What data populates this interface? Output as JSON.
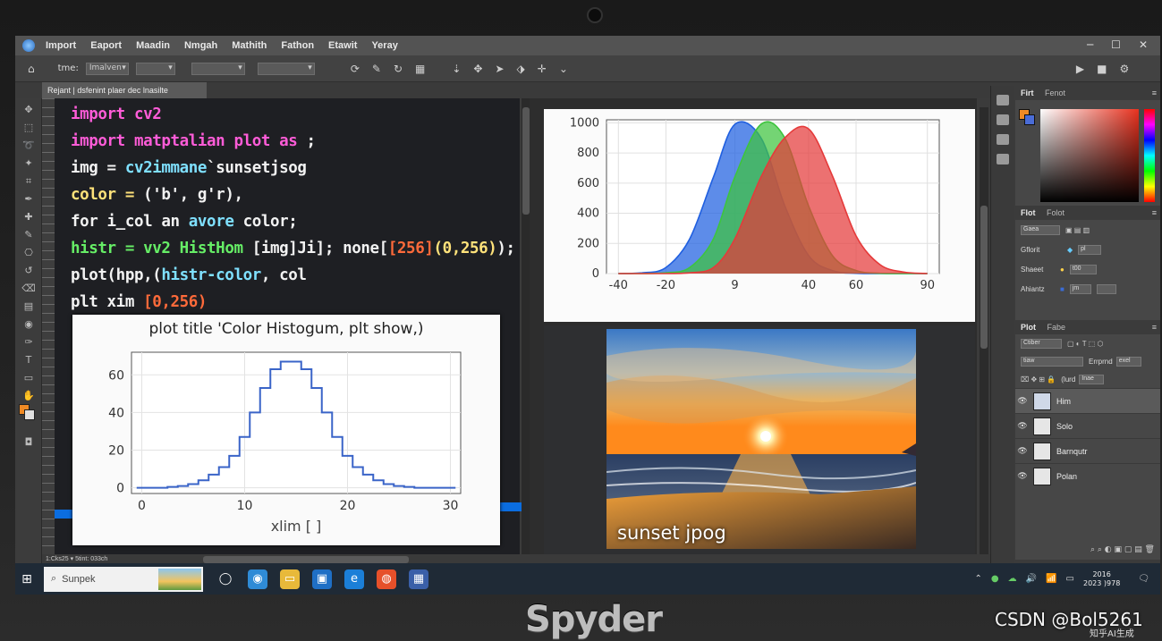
{
  "menu": [
    "Import",
    "Eaport",
    "Maadin",
    "Nmgah",
    "Mathith",
    "Fathon",
    "Etawit",
    "Yeray"
  ],
  "toolbar": {
    "field1_label": "tme:",
    "select1": "Imalven",
    "select2": "",
    "select3": "",
    "select4": ""
  },
  "doc_tab": "Rejant | dsfenint plaer  dec lnasilte",
  "code_lines": [
    {
      "parts": [
        {
          "t": "import ",
          "c": "kw"
        },
        {
          "t": "cv2",
          "c": "kw"
        }
      ]
    },
    {
      "parts": [
        {
          "t": "import ",
          "c": "kw"
        },
        {
          "t": "matptalian plot as ",
          "c": "kw"
        },
        {
          "t": ";",
          "c": "tx"
        }
      ]
    },
    {
      "parts": [
        {
          "t": "  img = ",
          "c": "tx"
        },
        {
          "t": "cv2immane",
          "c": "cy"
        },
        {
          "t": "`sunsetjsog",
          "c": "tx"
        }
      ]
    },
    {
      "parts": [
        {
          "t": "  color = ",
          "c": "yl"
        },
        {
          "t": "('b', g'r),",
          "c": "tx"
        }
      ]
    },
    {
      "parts": [
        {
          "t": "  for i_col an ",
          "c": "tx"
        },
        {
          "t": "avore",
          "c": "cy"
        },
        {
          "t": " color;",
          "c": "tx"
        }
      ]
    },
    {
      "parts": [
        {
          "t": "  histr = ",
          "c": "gr"
        },
        {
          "t": "vv2 HistHom",
          "c": "gr"
        },
        {
          "t": " [img]Ji]; none[",
          "c": "tx"
        },
        {
          "t": "[256]",
          "c": "or"
        },
        {
          "t": "(0,256)",
          "c": "yl"
        },
        {
          "t": ");",
          "c": "tx"
        }
      ]
    },
    {
      "parts": [
        {
          "t": "  plot(hpp,(",
          "c": "tx"
        },
        {
          "t": "histr-color",
          "c": "cy"
        },
        {
          "t": ", col",
          "c": "tx"
        }
      ]
    },
    {
      "parts": [
        {
          "t": "  plt xim ",
          "c": "tx"
        },
        {
          "t": "[0,256)",
          "c": "or"
        }
      ]
    }
  ],
  "figure2": {
    "title": "plot title 'Color Histogum, plt show,)",
    "xlabel": "xlim [ ]"
  },
  "sunset_label": "sunset jpog",
  "panels": {
    "color_tabs": [
      "Firt",
      "Fenot"
    ],
    "prop_tabs": [
      "Flot",
      "Folot"
    ],
    "prop_select": "Gaea",
    "prop_rows": [
      {
        "label": "Gflorit",
        "value": "pl"
      },
      {
        "label": "Shaeet",
        "value": "t00"
      },
      {
        "label": "Ahiantz",
        "value": "jm"
      }
    ],
    "layers_tabs": [
      "Plot",
      "Fabe"
    ],
    "layer_select1": "Ctiber",
    "layer_select2": "tiaw",
    "layer_opt1": "Errprnd",
    "layer_opt2": "exel",
    "layer_opt3": "(lurd",
    "layer_opt4": "Inae",
    "layers": [
      "Him",
      "Solo",
      "Barnqutr",
      "Polan"
    ]
  },
  "status": {
    "left": "1:Cks25 ▾   5tint: 033ch"
  },
  "taskbar": {
    "search_placeholder": "Sunpek",
    "clock_line1": "2016",
    "clock_line2": "2023 )978"
  },
  "brand": "Spyder",
  "watermark": "CSDN @Bol5261",
  "watermark2": "知乎AI生成",
  "chart_data": [
    {
      "type": "area",
      "x": [
        -40,
        -30,
        -20,
        -10,
        0,
        9,
        20,
        30,
        40,
        50,
        60,
        70,
        80,
        90
      ],
      "xticks": [
        -40,
        -20,
        9,
        40,
        60,
        90
      ],
      "yticks": [
        0,
        200,
        400,
        600,
        800,
        1000
      ],
      "xlim": [
        -45,
        95
      ],
      "ylim": [
        0,
        1020
      ],
      "series": [
        {
          "color": "#1f5fe0",
          "values": [
            0,
            5,
            40,
            230,
            640,
            990,
            900,
            450,
            120,
            20,
            2,
            0,
            0,
            0
          ]
        },
        {
          "color": "#3ec43e",
          "values": [
            0,
            0,
            5,
            40,
            230,
            640,
            990,
            900,
            450,
            120,
            20,
            2,
            0,
            0
          ]
        },
        {
          "color": "#e53a3a",
          "values": [
            0,
            0,
            0,
            5,
            40,
            230,
            640,
            900,
            960,
            650,
            250,
            60,
            10,
            0
          ]
        }
      ],
      "grid": true
    },
    {
      "type": "line",
      "title": "plot title 'Color Histogum, plt show,)",
      "xlabel": "xlim [ ]",
      "x": [
        0,
        1,
        2,
        3,
        4,
        5,
        6,
        7,
        8,
        9,
        10,
        11,
        12,
        13,
        14,
        15,
        16,
        17,
        18,
        19,
        20,
        21,
        22,
        23,
        24,
        25,
        26,
        27,
        28,
        29,
        30
      ],
      "values": [
        0,
        0,
        0,
        0.5,
        1,
        2,
        4,
        7,
        11,
        17,
        27,
        40,
        53,
        63,
        67,
        67,
        63,
        53,
        40,
        27,
        17,
        11,
        7,
        4,
        2,
        1,
        0.5,
        0,
        0,
        0,
        0
      ],
      "xticks": [
        0,
        10,
        20,
        30
      ],
      "yticks": [
        0,
        20,
        40,
        60
      ],
      "xlim": [
        -1,
        31
      ],
      "ylim": [
        -3,
        72
      ],
      "color": "#3a64c8",
      "grid": true
    }
  ]
}
